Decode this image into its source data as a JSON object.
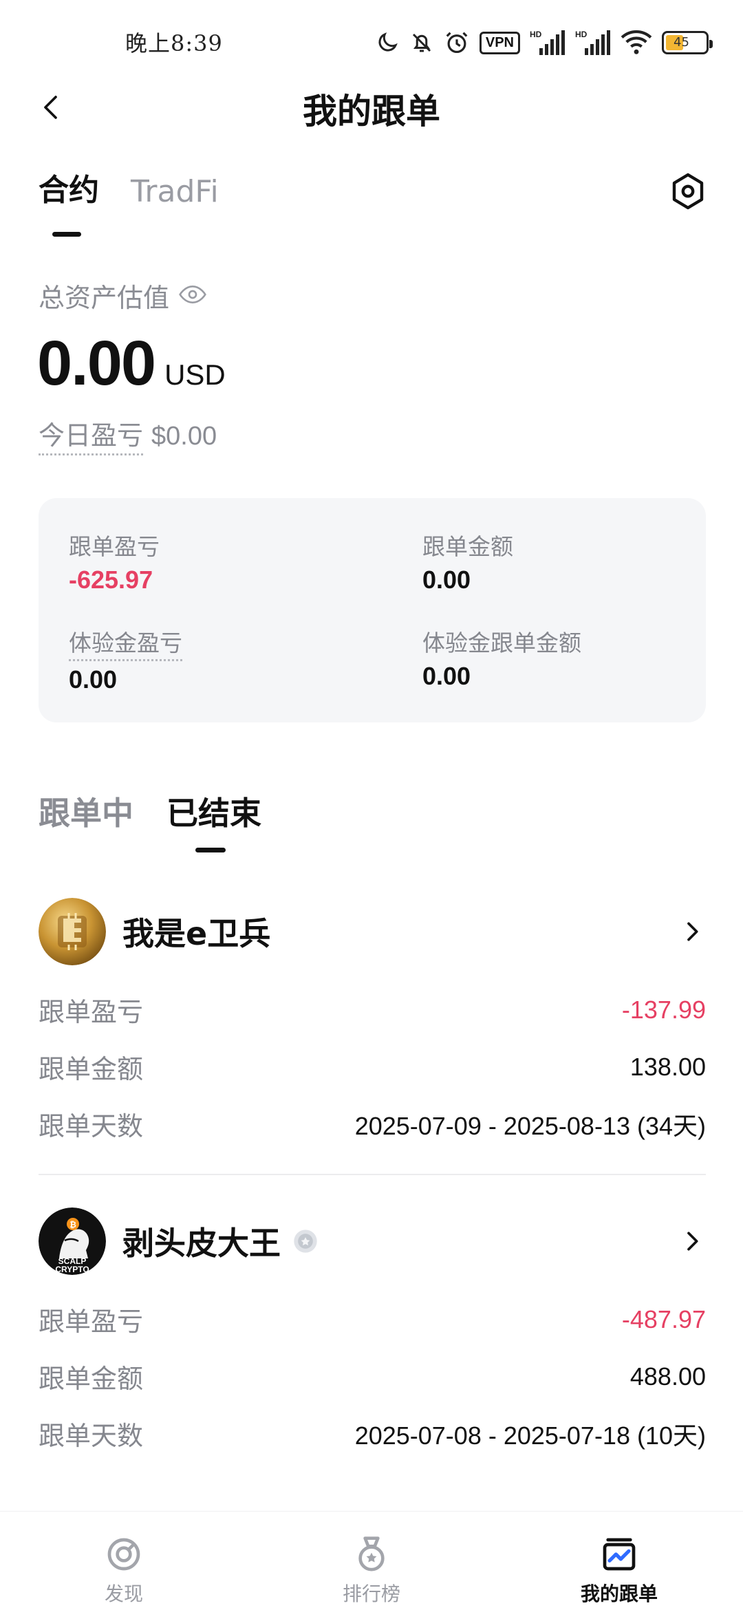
{
  "status_bar": {
    "time": "晚上8:39",
    "vpn": "VPN",
    "battery_level": "45",
    "icons": [
      "moon-icon",
      "bell-off-icon",
      "alarm-icon",
      "vpn-icon",
      "signal-hd-icon",
      "signal-hd-icon",
      "wifi-icon",
      "battery-icon"
    ]
  },
  "header": {
    "title": "我的跟单",
    "back_icon": "chevron-left-icon"
  },
  "top_tabs": {
    "items": [
      {
        "label": "合约",
        "active": true
      },
      {
        "label": "TradFi",
        "active": false
      }
    ],
    "settings_icon": "hexagon-settings-icon"
  },
  "assets": {
    "label": "总资产估值",
    "value": "0.00",
    "unit": "USD",
    "today_label": "今日盈亏",
    "today_value": "$0.00"
  },
  "summary": {
    "follow_pnl_label": "跟单盈亏",
    "follow_pnl_value": "-625.97",
    "follow_amount_label": "跟单金额",
    "follow_amount_value": "0.00",
    "trial_pnl_label": "体验金盈亏",
    "trial_pnl_value": "0.00",
    "trial_amount_label": "体验金跟单金额",
    "trial_amount_value": "0.00"
  },
  "sub_tabs": {
    "ongoing": "跟单中",
    "ended": "已结束"
  },
  "records": [
    {
      "name": "我是e卫兵",
      "pnl_label": "跟单盈亏",
      "pnl": "-137.99",
      "amount_label": "跟单金额",
      "amount": "138.00",
      "days_label": "跟单天数",
      "days": "2025-07-09 - 2025-08-13 (34天)"
    },
    {
      "name": "剥头皮大王",
      "avatar_text_1": "SCALP",
      "avatar_text_2": "CRYPTO",
      "pnl_label": "跟单盈亏",
      "pnl": "-487.97",
      "amount_label": "跟单金额",
      "amount": "488.00",
      "days_label": "跟单天数",
      "days": "2025-07-08 - 2025-07-18 (10天)"
    }
  ],
  "bottom_nav": [
    {
      "label": "发现",
      "icon": "discover-icon",
      "active": false
    },
    {
      "label": "排行榜",
      "icon": "medal-icon",
      "active": false
    },
    {
      "label": "我的跟单",
      "icon": "my-copy-icon",
      "active": true
    }
  ],
  "colors": {
    "negative": "#e64063",
    "muted": "#8a8c93",
    "card_bg": "#f5f6f8",
    "battery": "#f3b633"
  }
}
